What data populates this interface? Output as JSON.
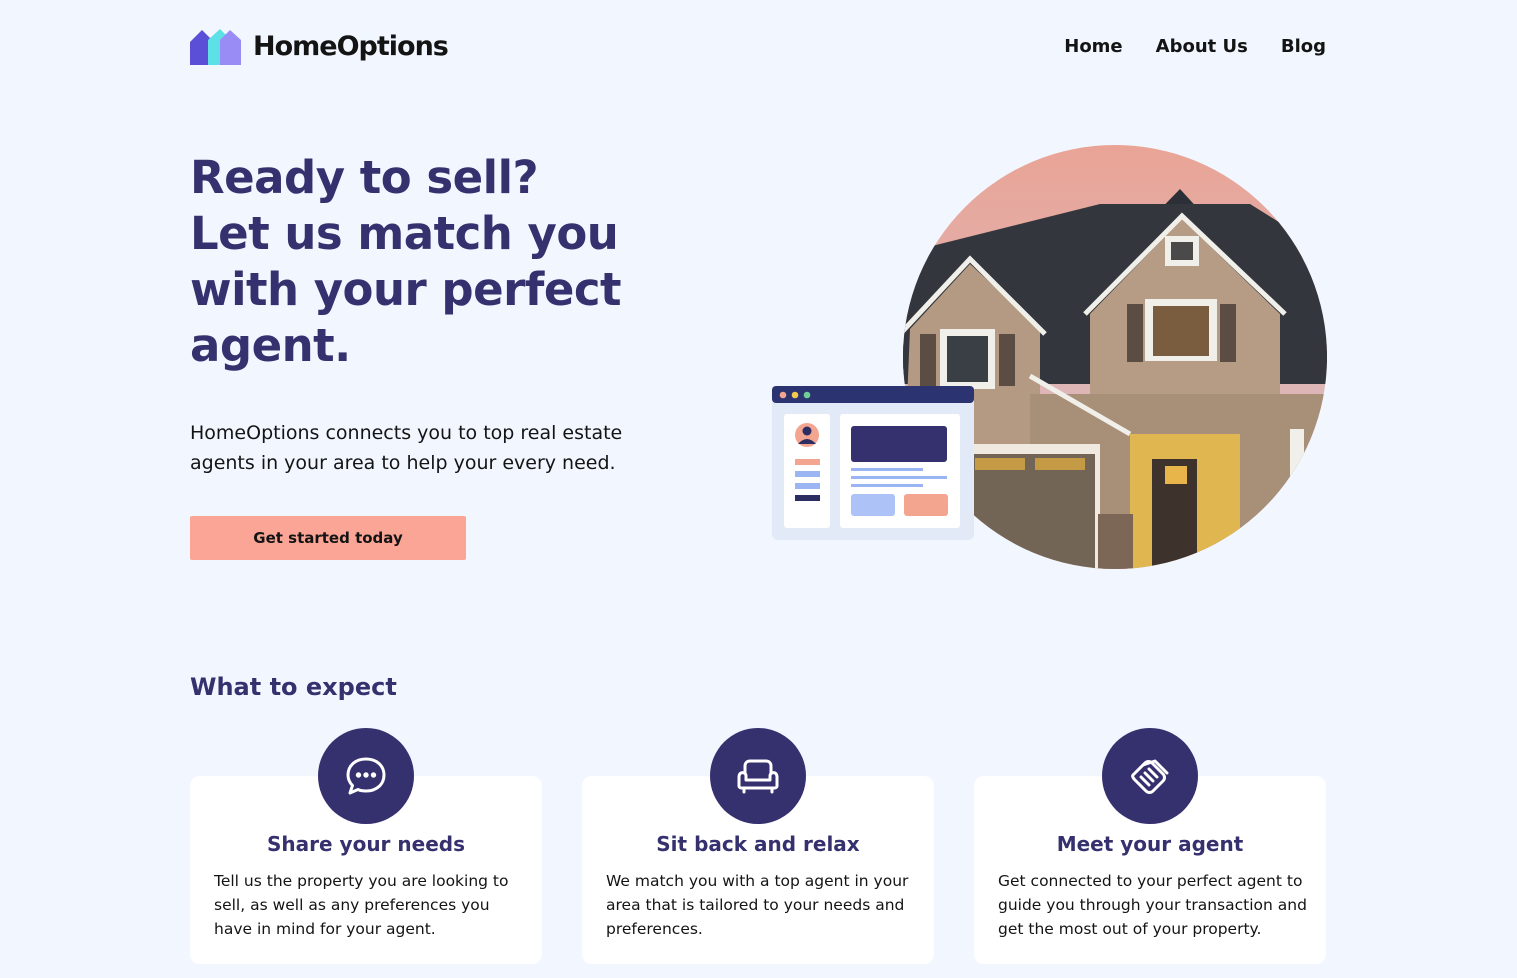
{
  "brand": {
    "name": "HomeOptions",
    "colors": {
      "primary": "#35306e",
      "accent": "#fba596",
      "background": "#f1f6ff",
      "logo_purple": "#7b6cf0",
      "logo_teal": "#5de0e6"
    }
  },
  "nav": {
    "items": [
      {
        "label": "Home"
      },
      {
        "label": "About Us"
      },
      {
        "label": "Blog"
      }
    ]
  },
  "hero": {
    "title_lines": [
      "Ready to sell?",
      "Let us match you",
      "with your perfect",
      "agent."
    ],
    "subtitle": "HomeOptions connects you to top real estate agents in your area to help your every need.",
    "cta_label": "Get started today",
    "image_icon": "house-photo-with-profile-window-illustration"
  },
  "expect": {
    "title": "What to expect",
    "cards": [
      {
        "icon": "chat-bubble-icon",
        "title": "Share your needs",
        "text": "Tell us the property you are looking to sell, as well as any preferences you have in mind for your agent."
      },
      {
        "icon": "couch-icon",
        "title": "Sit back and relax",
        "text": "We match you with a top agent in your area that is tailored to your needs and preferences."
      },
      {
        "icon": "handshake-icon",
        "title": "Meet your agent",
        "text": "Get connected to your perfect agent to guide you through your transaction and get the most out of your property."
      }
    ]
  }
}
